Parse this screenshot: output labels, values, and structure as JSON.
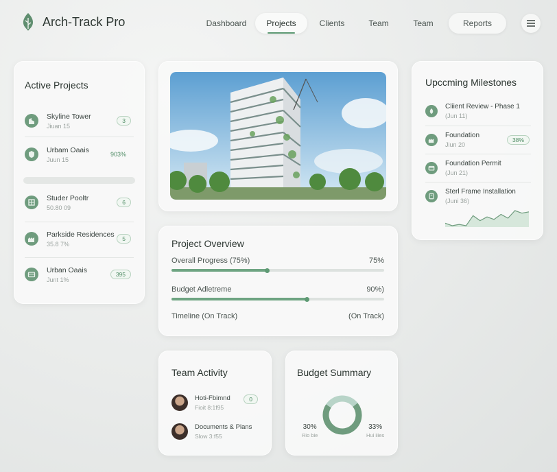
{
  "app": {
    "title": "Arch-Track Pro"
  },
  "nav": {
    "items": [
      {
        "label": "Dashboard"
      },
      {
        "label": "Projects"
      },
      {
        "label": "Clients"
      },
      {
        "label": "Team"
      },
      {
        "label": "Team"
      },
      {
        "label": "Reports"
      }
    ]
  },
  "active_projects": {
    "title": "Active Projects",
    "items": [
      {
        "name": "Skyline Tower",
        "sub": "Jiuan 15",
        "badge": "3",
        "icon": "building-icon"
      },
      {
        "name": "Urbam Oaais",
        "sub": "Juun 15",
        "badge": "903%",
        "icon": "shield-icon"
      },
      {
        "name": "Studer Pooltr",
        "sub": "50.80 09",
        "badge": "6",
        "icon": "grid-icon"
      },
      {
        "name": "Parkside Residences",
        "sub": "35.8 7%",
        "badge": "5",
        "icon": "factory-icon"
      },
      {
        "name": "Urban Oaais",
        "sub": "Junt 1%",
        "badge": "395",
        "icon": "card-icon"
      }
    ]
  },
  "milestones": {
    "title": "Upccming Milestones",
    "items": [
      {
        "name": "Cliient Review - Phase 1",
        "date": "(Jun 11)",
        "badge": "",
        "icon": "leaf-icon"
      },
      {
        "name": "Foundation",
        "date": "Jiun 20",
        "badge": "38%",
        "icon": "factory-icon"
      },
      {
        "name": "Foundation Permit",
        "date": "(Jun 21)",
        "badge": "",
        "icon": "card-icon"
      },
      {
        "name": "Sterl Frame Installation",
        "date": "(Juni 36)",
        "badge": "",
        "icon": "book-icon"
      }
    ],
    "sparkline": [
      3,
      2,
      2.5,
      2,
      6,
      4,
      5.5,
      4.5,
      6.5,
      5,
      8,
      7,
      7.5
    ]
  },
  "overview": {
    "title": "Project Overview",
    "progress_label": "Overall Progress (75%)",
    "progress_value": "75%",
    "progress_fill": 0.45,
    "budget_label": "Budget Adletreme",
    "budget_value": "90%)",
    "budget_fill": 0.64,
    "timeline_label": "Timeline (On Track)",
    "timeline_value": "(On Track)"
  },
  "team_activity": {
    "title": "Team Activity",
    "items": [
      {
        "name": "Hoti-Fbimnd",
        "sub": "Fioit 8:1f95",
        "badge": "0"
      },
      {
        "name": "Documents & Plans",
        "sub": "Slow 3:f55",
        "badge": ""
      }
    ]
  },
  "budget_summary": {
    "title": "Budget Summary",
    "left_value": "30%",
    "left_sub": "Rio bie",
    "right_value": "33%",
    "right_sub": "Hui iiies",
    "donut": [
      0.7,
      0.3
    ]
  },
  "colors": {
    "accent": "#6f9c7e",
    "accent_dark": "#4c8a62",
    "track": "#dde2df"
  }
}
